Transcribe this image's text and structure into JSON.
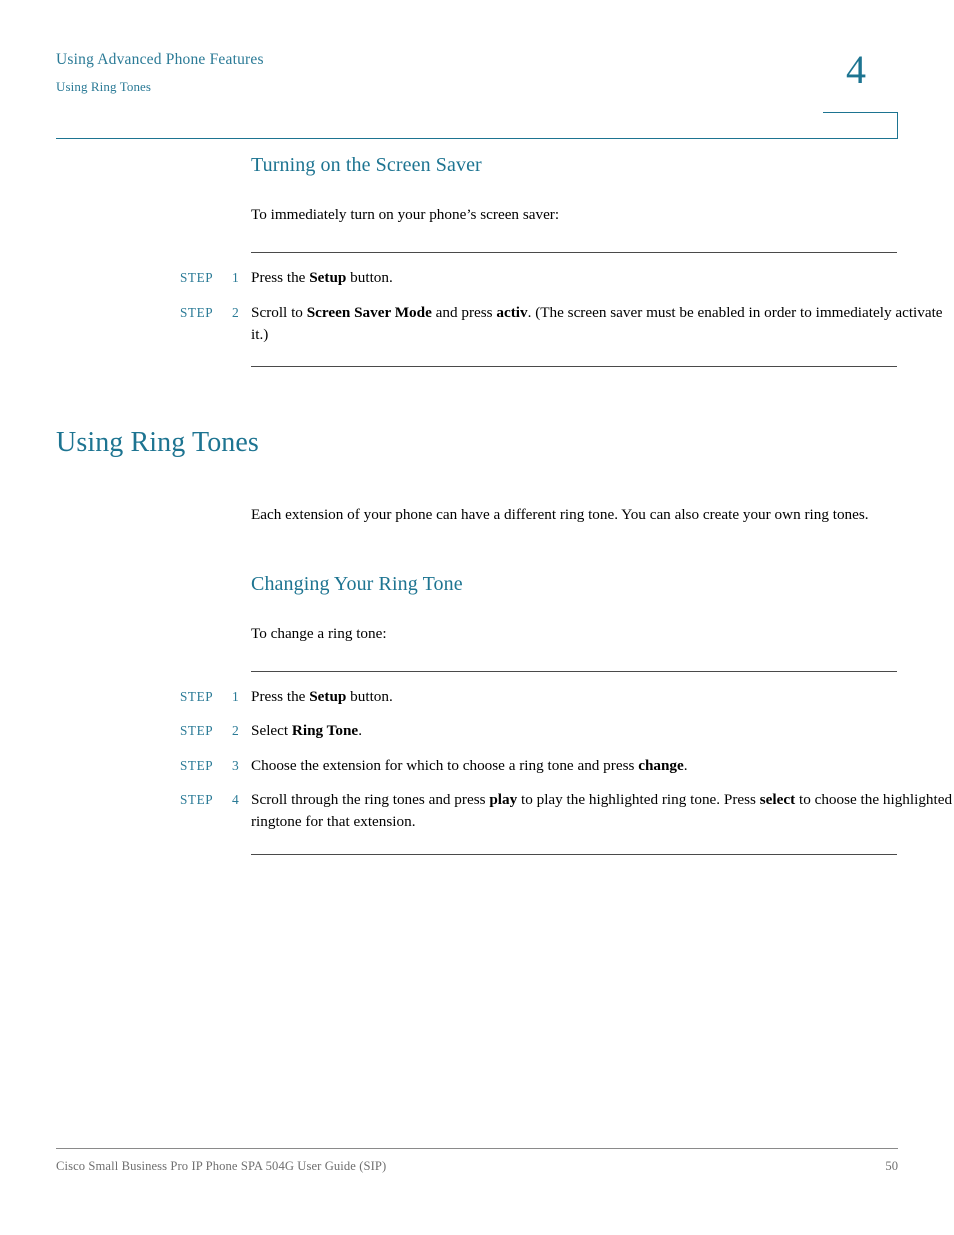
{
  "header": {
    "chapter_title": "Using Advanced Phone Features",
    "section_title": "Using Ring Tones",
    "chapter_number": "4",
    "rule_color": "#1d7491"
  },
  "colors": {
    "accent_teal": "#1d7491",
    "header_teal": "#2a7a96",
    "body_black": "#000000",
    "footer_gray": "#6e6e6e",
    "rule_gray": "#4a4a4a"
  },
  "sections": {
    "screen_saver": {
      "heading": "Turning on the Screen Saver",
      "intro": "To immediately turn on your phone’s screen saver:",
      "steps": [
        {
          "label": "STEP",
          "number": "1",
          "parts": [
            {
              "text": "Press the ",
              "bold": false
            },
            {
              "text": "Setup",
              "bold": true
            },
            {
              "text": " button.",
              "bold": false
            }
          ]
        },
        {
          "label": "STEP",
          "number": "2",
          "parts": [
            {
              "text": "Scroll to ",
              "bold": false
            },
            {
              "text": "Screen Saver Mode",
              "bold": true
            },
            {
              "text": " and press ",
              "bold": false
            },
            {
              "text": "activ",
              "bold": true
            },
            {
              "text": ". (The screen saver must be enabled in order to immediately activate it.)",
              "bold": false
            }
          ]
        }
      ]
    },
    "ring_tones": {
      "heading": "Using Ring Tones",
      "intro": "Each extension of your phone can have a different ring tone. You can also create your own ring tones.",
      "subsection": {
        "heading": "Changing Your Ring Tone",
        "intro": "To change a ring tone:",
        "steps": [
          {
            "label": "STEP",
            "number": "1",
            "parts": [
              {
                "text": "Press the ",
                "bold": false
              },
              {
                "text": "Setup",
                "bold": true
              },
              {
                "text": " button.",
                "bold": false
              }
            ]
          },
          {
            "label": "STEP",
            "number": "2",
            "parts": [
              {
                "text": "Select ",
                "bold": false
              },
              {
                "text": "Ring Tone",
                "bold": true
              },
              {
                "text": ".",
                "bold": false
              }
            ]
          },
          {
            "label": "STEP",
            "number": "3",
            "parts": [
              {
                "text": "Choose the extension for which to choose a ring tone and press ",
                "bold": false
              },
              {
                "text": "change",
                "bold": true
              },
              {
                "text": ".",
                "bold": false
              }
            ]
          },
          {
            "label": "STEP",
            "number": "4",
            "parts": [
              {
                "text": "Scroll through the ring tones and press ",
                "bold": false
              },
              {
                "text": "play",
                "bold": true
              },
              {
                "text": " to play the highlighted ring tone. Press ",
                "bold": false
              },
              {
                "text": "select",
                "bold": true
              },
              {
                "text": " to choose the highlighted ringtone for that extension.",
                "bold": false
              }
            ]
          }
        ]
      }
    }
  },
  "footer": {
    "document_title": "Cisco Small Business Pro IP Phone SPA 504G User Guide (SIP)",
    "page_number": "50"
  }
}
